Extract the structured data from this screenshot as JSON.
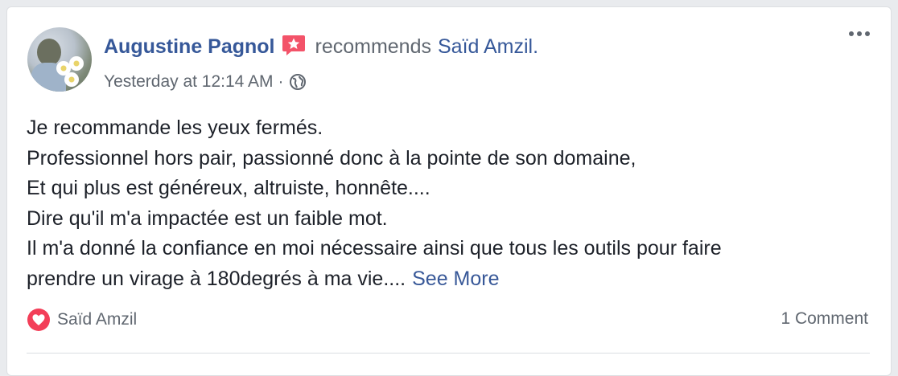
{
  "post": {
    "author": "Augustine Pagnol",
    "verb": "recommends",
    "target": "Saïd Amzil.",
    "timestamp": "Yesterday at 12:14 AM",
    "separator": "·",
    "privacy_icon": "globe-icon",
    "badge_icon": "recommendation-star-icon",
    "more_icon": "more-options-icon",
    "body_lines": [
      "Je recommande les yeux fermés.",
      "Professionnel hors pair, passionné donc à la pointe de son domaine,",
      "Et qui plus est généreux, altruiste, honnête....",
      "Dire qu'il m'a impactée est un faible mot.",
      "Il m'a donné la confiance en moi nécessaire ainsi que tous les outils pour faire",
      "prendre un virage à 180degrés à ma vie...."
    ],
    "see_more": "See More"
  },
  "footer": {
    "reaction_icon": "love-reaction-icon",
    "reaction_by": "Saïd Amzil",
    "comments": "1 Comment"
  },
  "colors": {
    "link": "#365899",
    "meta": "#606770",
    "reaction_red": "#f33e58",
    "badge_red": "#f35369"
  }
}
